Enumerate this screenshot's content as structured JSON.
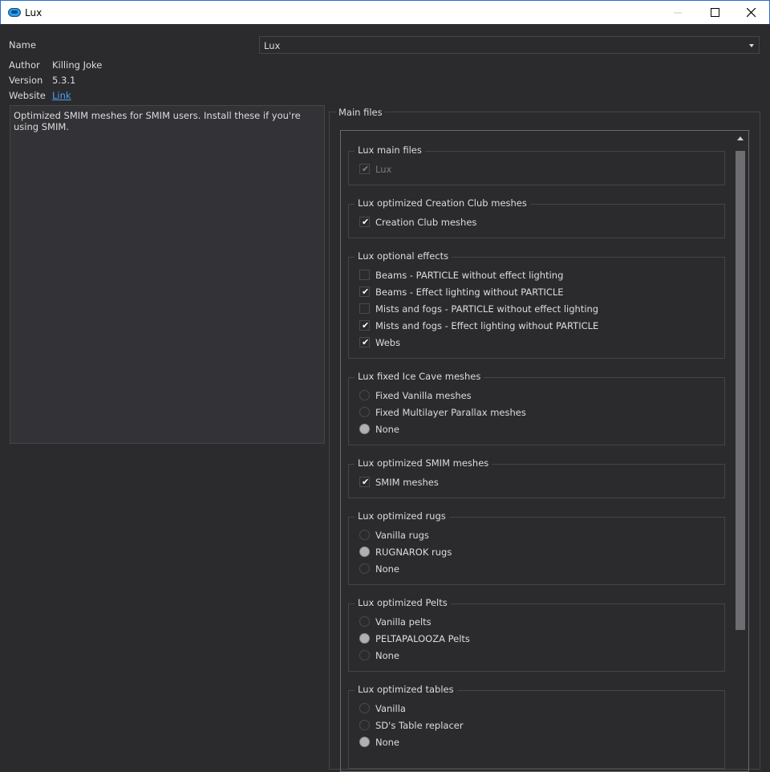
{
  "window": {
    "title": "Lux"
  },
  "form": {
    "name_label": "Name",
    "name_value": "Lux",
    "author_label": "Author",
    "author_value": "Killing Joke",
    "version_label": "Version",
    "version_value": "5.3.1",
    "website_label": "Website",
    "website_link": "Link",
    "description": "Optimized SMIM meshes for SMIM users. Install these if you're using SMIM."
  },
  "main_files": {
    "title": "Main files",
    "groups": [
      {
        "title": "Lux main files",
        "options": [
          {
            "label": "Lux",
            "type": "checkbox",
            "checked": true,
            "disabled": true
          }
        ]
      },
      {
        "title": "Lux optimized Creation Club meshes",
        "options": [
          {
            "label": "Creation Club meshes",
            "type": "checkbox",
            "checked": true
          }
        ]
      },
      {
        "title": "Lux optional effects",
        "options": [
          {
            "label": "Beams - PARTICLE without effect lighting",
            "type": "checkbox",
            "checked": false
          },
          {
            "label": "Beams - Effect lighting without PARTICLE",
            "type": "checkbox",
            "checked": true
          },
          {
            "label": "Mists and fogs - PARTICLE without effect lighting",
            "type": "checkbox",
            "checked": false
          },
          {
            "label": "Mists and fogs - Effect lighting without PARTICLE",
            "type": "checkbox",
            "checked": true
          },
          {
            "label": "Webs",
            "type": "checkbox",
            "checked": true
          }
        ]
      },
      {
        "title": "Lux fixed Ice Cave meshes",
        "options": [
          {
            "label": "Fixed Vanilla meshes",
            "type": "radio",
            "checked": false
          },
          {
            "label": "Fixed Multilayer Parallax meshes",
            "type": "radio",
            "checked": false
          },
          {
            "label": "None",
            "type": "radio",
            "checked": true
          }
        ]
      },
      {
        "title": "Lux optimized SMIM meshes",
        "options": [
          {
            "label": "SMIM meshes",
            "type": "checkbox",
            "checked": true
          }
        ]
      },
      {
        "title": "Lux optimized rugs",
        "options": [
          {
            "label": "Vanilla rugs",
            "type": "radio",
            "checked": false
          },
          {
            "label": "RUGNAROK rugs",
            "type": "radio",
            "checked": true
          },
          {
            "label": "None",
            "type": "radio",
            "checked": false
          }
        ]
      },
      {
        "title": "Lux optimized Pelts",
        "options": [
          {
            "label": "Vanilla pelts",
            "type": "radio",
            "checked": false
          },
          {
            "label": "PELTAPALOOZA Pelts",
            "type": "radio",
            "checked": true
          },
          {
            "label": "None",
            "type": "radio",
            "checked": false
          }
        ]
      },
      {
        "title": "Lux optimized tables",
        "options": [
          {
            "label": "Vanilla",
            "type": "radio",
            "checked": false
          },
          {
            "label": "SD's Table replacer",
            "type": "radio",
            "checked": false
          },
          {
            "label": "None",
            "type": "radio",
            "checked": true
          }
        ]
      }
    ]
  },
  "icons": {
    "app": "lux-app-icon",
    "minimize": "minimize-icon",
    "maximize": "maximize-icon",
    "close": "close-icon",
    "dropdown": "chevron-down-icon",
    "scroll_up": "scroll-up-arrow-icon"
  },
  "colors": {
    "background": "#2b2b2e",
    "link": "#4a9ff5",
    "titlebar": "#ffffff",
    "border": "#454549"
  }
}
